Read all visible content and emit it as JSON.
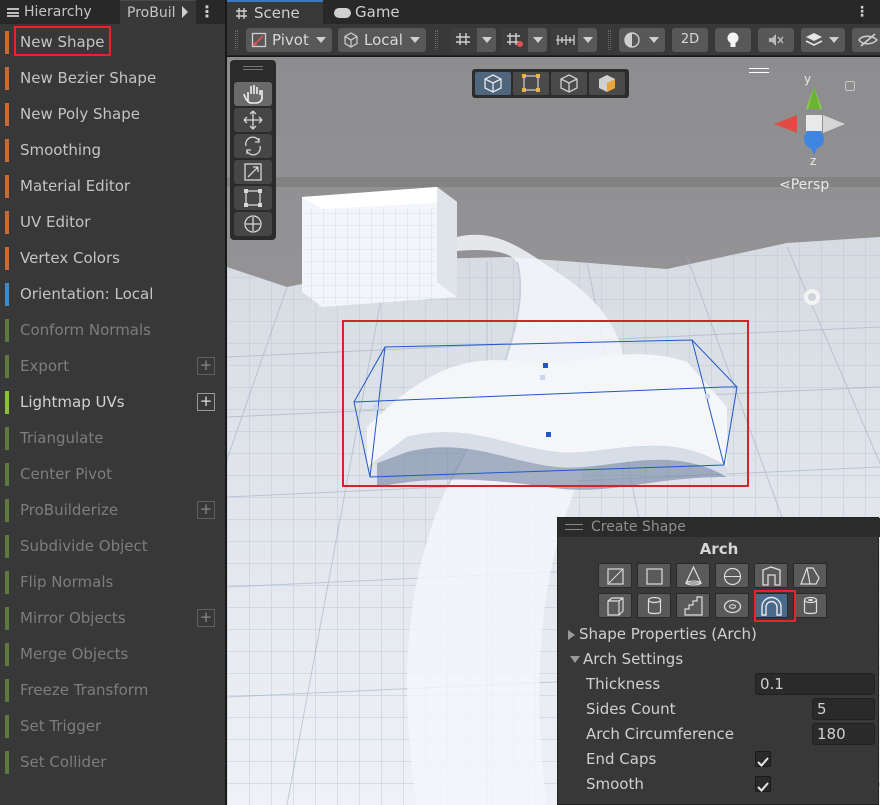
{
  "left_panel": {
    "tabs": {
      "hierarchy": "Hierarchy",
      "probuilder": "ProBuil"
    },
    "items": [
      {
        "label": "New Shape",
        "color": "#c86a33",
        "state": "normal",
        "plus": false
      },
      {
        "label": "New Bezier Shape",
        "color": "#c86a33",
        "state": "normal",
        "plus": false
      },
      {
        "label": "New Poly Shape",
        "color": "#c86a33",
        "state": "normal",
        "plus": false
      },
      {
        "label": "Smoothing",
        "color": "#c86a33",
        "state": "normal",
        "plus": false
      },
      {
        "label": "Material Editor",
        "color": "#c86a33",
        "state": "normal",
        "plus": false
      },
      {
        "label": "UV Editor",
        "color": "#c86a33",
        "state": "normal",
        "plus": false
      },
      {
        "label": "Vertex Colors",
        "color": "#c86a33",
        "state": "normal",
        "plus": false
      },
      {
        "label": "Orientation: Local",
        "color": "#3d8cc8",
        "state": "normal",
        "plus": false
      },
      {
        "label": "Conform Normals",
        "color": "#5d7a3d",
        "state": "dim",
        "plus": false
      },
      {
        "label": "Export",
        "color": "#5d7a3d",
        "state": "dim",
        "plus": true
      },
      {
        "label": "Lightmap UVs",
        "color": "#86c23f",
        "state": "bright",
        "plus": true
      },
      {
        "label": "Triangulate",
        "color": "#5d7a3d",
        "state": "dim",
        "plus": false
      },
      {
        "label": "Center Pivot",
        "color": "#5d7a3d",
        "state": "dim",
        "plus": false
      },
      {
        "label": "ProBuilderize",
        "color": "#5d7a3d",
        "state": "dim",
        "plus": true
      },
      {
        "label": "Subdivide Object",
        "color": "#5d7a3d",
        "state": "dim",
        "plus": false
      },
      {
        "label": "Flip Normals",
        "color": "#5d7a3d",
        "state": "dim",
        "plus": false
      },
      {
        "label": "Mirror Objects",
        "color": "#5d7a3d",
        "state": "dim",
        "plus": true
      },
      {
        "label": "Merge Objects",
        "color": "#5d7a3d",
        "state": "dim",
        "plus": false
      },
      {
        "label": "Freeze Transform",
        "color": "#5d7a3d",
        "state": "dim",
        "plus": false
      },
      {
        "label": "Set Trigger",
        "color": "#5d7a3d",
        "state": "dim",
        "plus": false
      },
      {
        "label": "Set Collider",
        "color": "#5d7a3d",
        "state": "dim",
        "plus": false
      }
    ],
    "plus_symbol": "+"
  },
  "right_tabs": {
    "scene": "Scene",
    "game": "Game"
  },
  "toolbar": {
    "pivot": "Pivot",
    "local": "Local",
    "twod": "2D"
  },
  "gizmo": {
    "y": "y",
    "z": "z",
    "persp": "Persp"
  },
  "create_shape": {
    "title": "Create Shape",
    "shape_name": "Arch",
    "shape_icons_row1": [
      "sprite-icon",
      "plane-icon",
      "cone-icon",
      "sphere-icon",
      "door-icon",
      "prism-icon"
    ],
    "shape_icons_row2": [
      "cube-icon",
      "cylinder-icon",
      "stairs-icon",
      "torus-icon",
      "arch-icon",
      "pipe-icon"
    ],
    "shape_properties": "Shape Properties (Arch)",
    "arch_settings": "Arch Settings",
    "props": {
      "thickness_label": "Thickness",
      "thickness": "0.1",
      "sides_label": "Sides Count",
      "sides": "5",
      "circ_label": "Arch Circumference",
      "circ": "180",
      "endcaps_label": "End Caps",
      "smooth_label": "Smooth"
    }
  }
}
